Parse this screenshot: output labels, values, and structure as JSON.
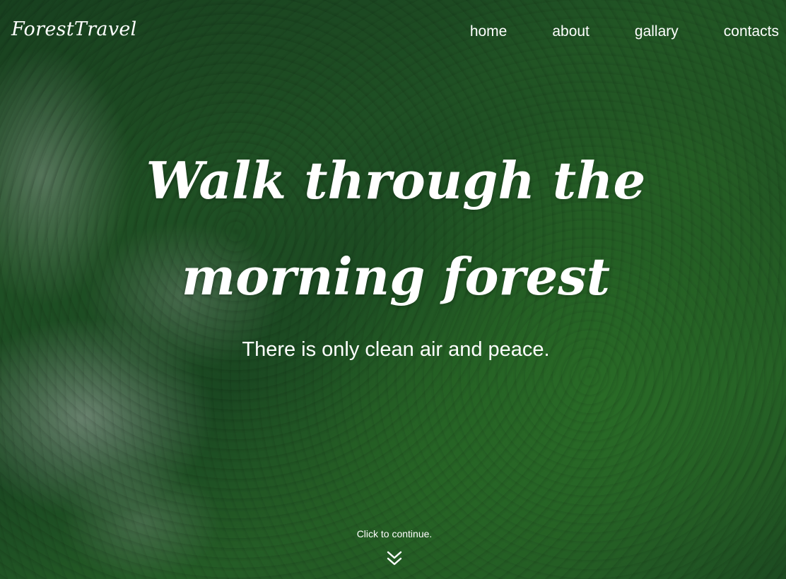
{
  "header": {
    "logo": "ForestTravel",
    "nav": [
      {
        "label": "home"
      },
      {
        "label": "about"
      },
      {
        "label": "gallary"
      },
      {
        "label": "contacts"
      }
    ]
  },
  "hero": {
    "headline": "Walk through the morning forest",
    "subline": "There is only clean air and peace.",
    "continue_text": "Click to continue.",
    "continue_icon": "double-chevron-down-icon"
  },
  "colors": {
    "text": "#ffffff",
    "forest_dark": "#1c4a24",
    "forest_light": "#2f7a2c",
    "mist": "#bec8c3"
  }
}
